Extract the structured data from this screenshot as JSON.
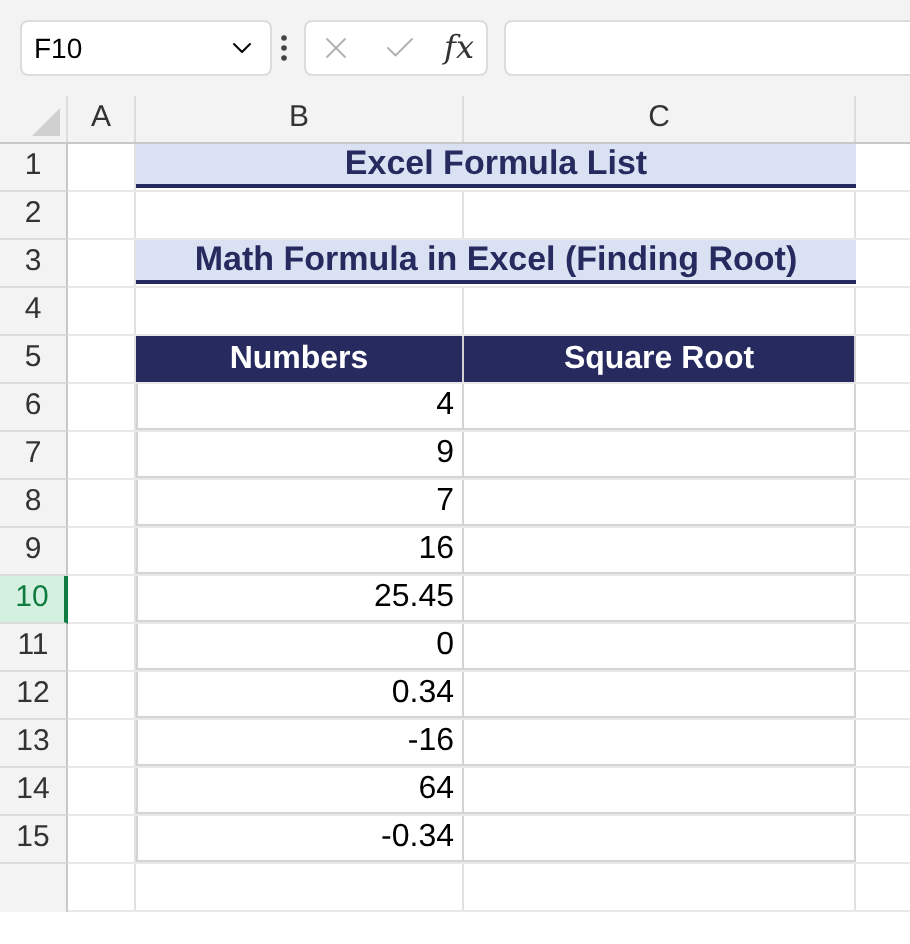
{
  "name_box": {
    "value": "F10"
  },
  "formula_bar": {
    "function_label": "fx"
  },
  "column_headers": [
    "A",
    "B",
    "C"
  ],
  "row_headers": [
    {
      "label": "1",
      "selected": false
    },
    {
      "label": "2",
      "selected": false
    },
    {
      "label": "3",
      "selected": false
    },
    {
      "label": "4",
      "selected": false
    },
    {
      "label": "5",
      "selected": false
    },
    {
      "label": "6",
      "selected": false
    },
    {
      "label": "7",
      "selected": false
    },
    {
      "label": "8",
      "selected": false
    },
    {
      "label": "9",
      "selected": false
    },
    {
      "label": "10",
      "selected": true
    },
    {
      "label": "11",
      "selected": false
    },
    {
      "label": "12",
      "selected": false
    },
    {
      "label": "13",
      "selected": false
    },
    {
      "label": "14",
      "selected": false
    },
    {
      "label": "15",
      "selected": false
    }
  ],
  "title": "Excel Formula List",
  "subtitle": "Math Formula in Excel (Finding Root)",
  "table": {
    "columns": [
      "Numbers",
      "Square Root"
    ],
    "rows": [
      "4",
      "9",
      "7",
      "16",
      "25.45",
      "0",
      "0.34",
      "-16",
      "64",
      "-0.34"
    ]
  }
}
